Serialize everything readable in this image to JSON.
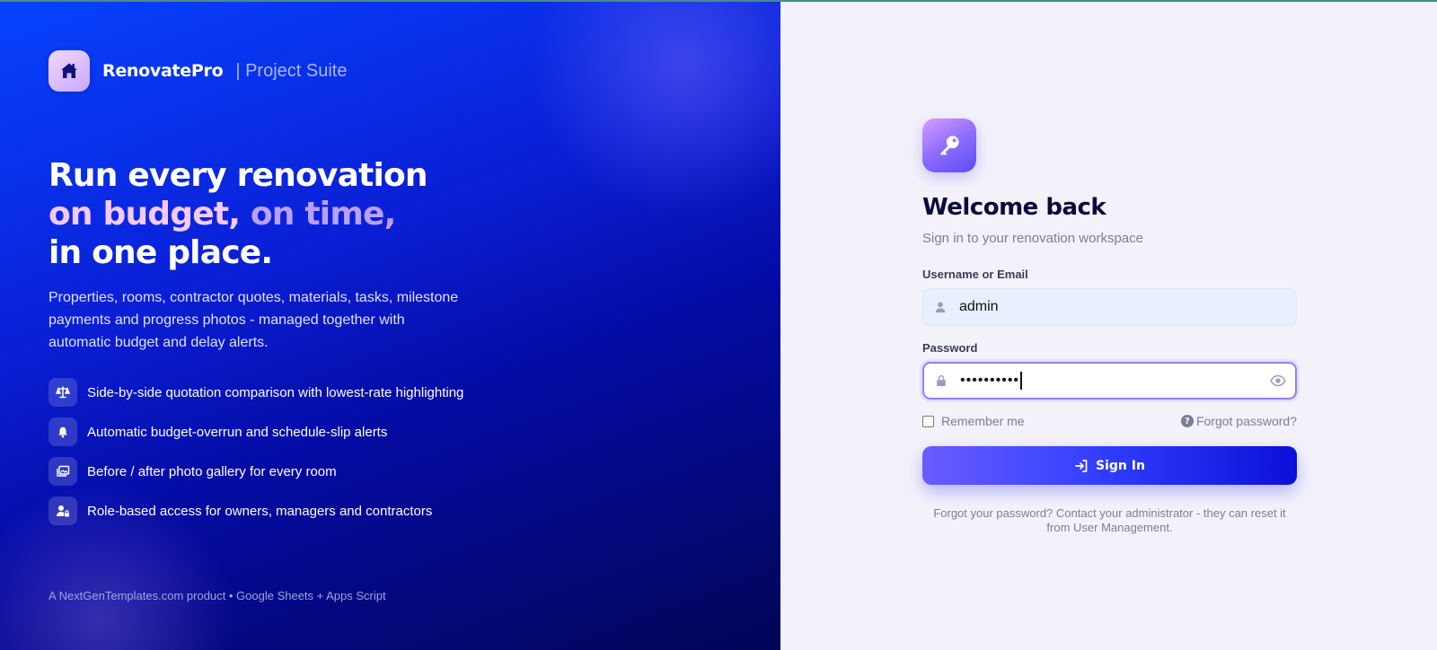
{
  "brand": {
    "name": "RenovatePro",
    "suite": "| Project Suite",
    "logo_icon": "house-icon"
  },
  "hero": {
    "line1": "Run every renovation",
    "line2a": "on budget,",
    "line2b": " on time,",
    "line3": "in one place."
  },
  "description": "Properties, rooms, contractor quotes, materials, tasks, milestone payments and progress photos - managed together with automatic budget and delay alerts.",
  "features": [
    {
      "icon": "scale-icon",
      "text": "Side-by-side quotation comparison with lowest-rate highlighting"
    },
    {
      "icon": "bell-icon",
      "text": "Automatic budget-overrun and schedule-slip alerts"
    },
    {
      "icon": "gallery-icon",
      "text": "Before / after photo gallery for every room"
    },
    {
      "icon": "user-lock-icon",
      "text": "Role-based access for owners, managers and contractors"
    }
  ],
  "footer": "A NextGenTemplates.com product • Google Sheets + Apps Script",
  "login": {
    "title": "Welcome back",
    "subtitle": "Sign in to your renovation workspace",
    "username_label": "Username or Email",
    "username_value": "admin",
    "password_label": "Password",
    "password_value": "••••••••••",
    "remember_label": "Remember me",
    "forgot_label": "Forgot password?",
    "signin_label": "Sign In",
    "help_text": "Forgot your password? Contact your administrator - they can reset it from User Management."
  },
  "colors": {
    "accent": "#6a5cff",
    "panel_dark": "#010656",
    "panel_bright": "#0743ff"
  }
}
